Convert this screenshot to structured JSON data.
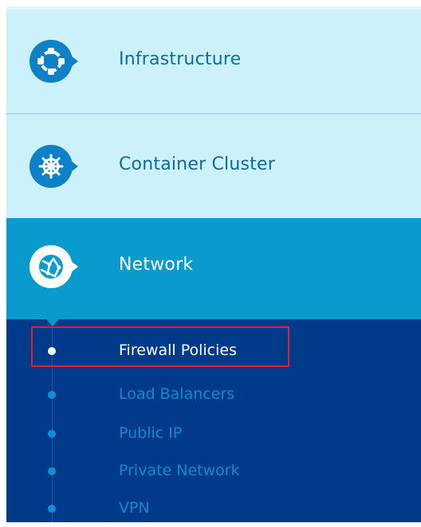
{
  "sidebar": {
    "items": [
      {
        "label": "Infrastructure",
        "icon": "infrastructure-icon",
        "active": false
      },
      {
        "label": "Container Cluster",
        "icon": "helm-wheel-icon",
        "active": false
      },
      {
        "label": "Network",
        "icon": "globe-network-icon",
        "active": true
      }
    ],
    "network_submenu": [
      {
        "label": "Firewall Policies",
        "selected": true
      },
      {
        "label": "Load Balancers",
        "selected": false
      },
      {
        "label": "Public IP",
        "selected": false
      },
      {
        "label": "Private Network",
        "selected": false
      },
      {
        "label": "VPN",
        "selected": false
      }
    ]
  },
  "colors": {
    "nav_bg": "#ccf1fb",
    "active_bg": "#0a9bce",
    "submenu_bg": "#003a88",
    "icon_circle": "#0c81c8",
    "label_text": "#0d6aa2",
    "submenu_text": "#1488cf",
    "highlight_border": "#e0202a"
  }
}
